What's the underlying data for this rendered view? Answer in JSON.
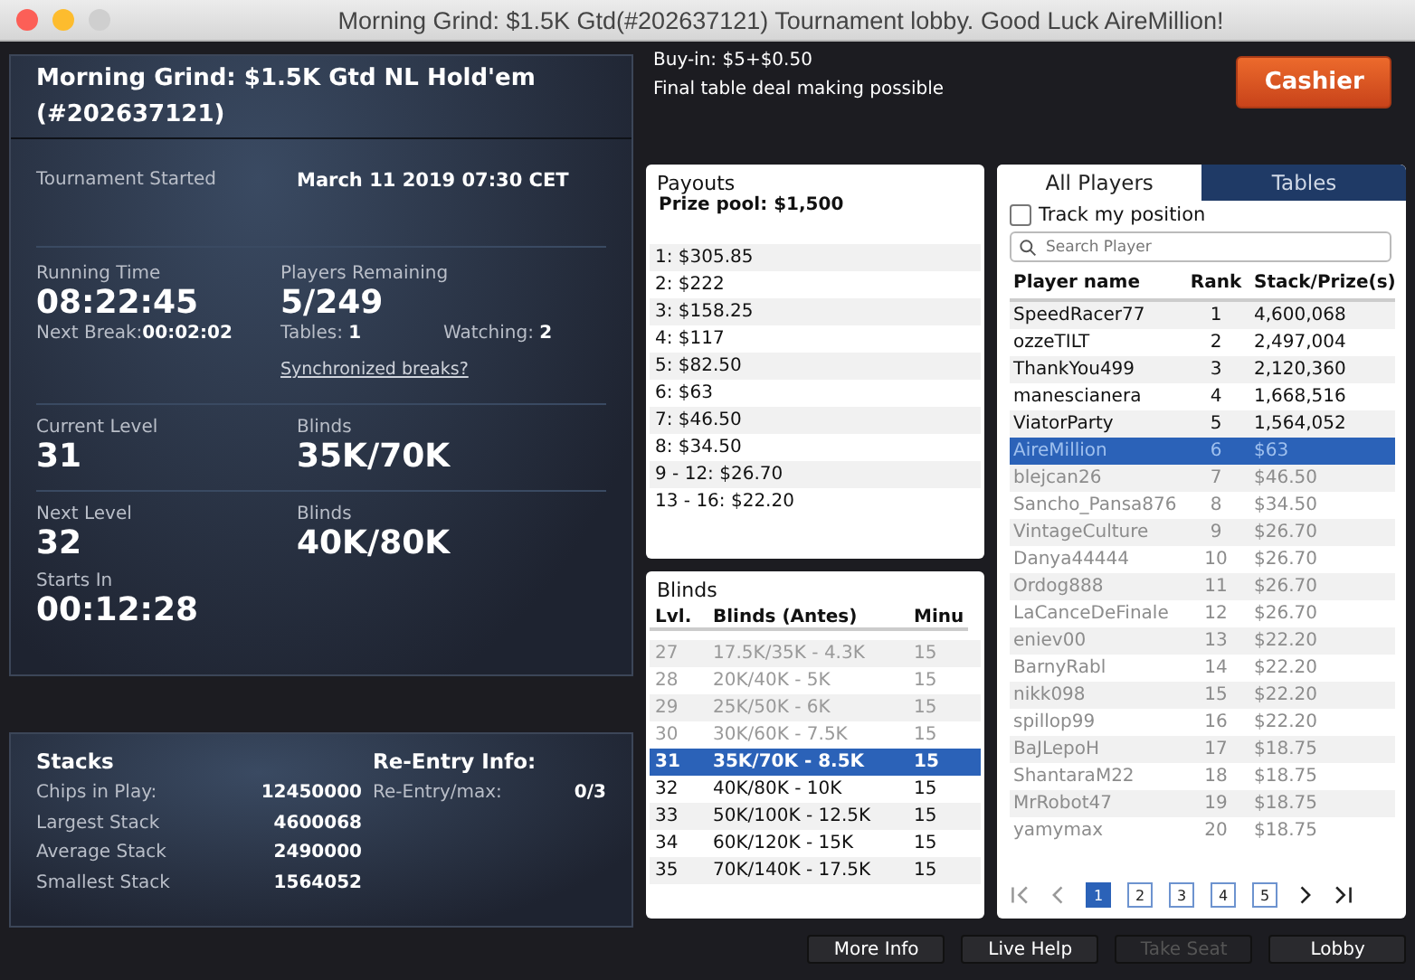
{
  "window": {
    "title": "Morning Grind: $1.5K Gtd(#202637121) Tournament lobby. Good Luck AireMillion!"
  },
  "tournament": {
    "name": "Morning Grind: $1.5K Gtd NL Hold'em (#202637121)",
    "started_label": "Tournament Started",
    "started_value": "March 11 2019 07:30 CET",
    "running_label": "Running Time",
    "running_value": "08:22:45",
    "next_break_label": "Next Break:",
    "next_break_value": "00:02:02",
    "players_label": "Players Remaining",
    "players_value": "5/249",
    "tables_label": "Tables:",
    "tables_value": "1",
    "watching_label": "Watching:",
    "watching_value": "2",
    "sync_link": "Synchronized breaks?",
    "current_level_label": "Current Level",
    "current_level_value": "31",
    "current_blinds_label": "Blinds",
    "current_blinds_value": "35K/70K",
    "next_level_label": "Next Level",
    "next_level_value": "32",
    "next_blinds_label": "Blinds",
    "next_blinds_value": "40K/80K",
    "starts_in_label": "Starts In",
    "starts_in_value": "00:12:28"
  },
  "info": {
    "buy_in": "Buy-in: $5+$0.50",
    "deal": "Final table deal making possible"
  },
  "cashier_button": "Cashier",
  "stacks": {
    "title": "Stacks",
    "rows": [
      {
        "label": "Chips in Play:",
        "value": "12450000"
      },
      {
        "label": "Largest Stack",
        "value": "4600068"
      },
      {
        "label": "Average Stack",
        "value": "2490000"
      },
      {
        "label": "Smallest Stack",
        "value": "1564052"
      }
    ],
    "reentry_title": "Re-Entry Info:",
    "reentry_label": "Re-Entry/max:",
    "reentry_value": "0/3"
  },
  "payouts": {
    "title": "Payouts",
    "prize_pool": "Prize pool: $1,500",
    "rows": [
      "1: $305.85",
      "2: $222",
      "3: $158.25",
      "4: $117",
      "5: $82.50",
      "6: $63",
      "7: $46.50",
      "8: $34.50",
      "9 - 12: $26.70",
      "13 - 16: $22.20"
    ]
  },
  "blinds": {
    "title": "Blinds",
    "columns": [
      "Lvl.",
      "Blinds (Antes)",
      "Minu"
    ],
    "rows": [
      {
        "level": "27",
        "blinds": "17.5K/35K - 4.3K",
        "minutes": "15",
        "past": true,
        "selected": false
      },
      {
        "level": "28",
        "blinds": "20K/40K - 5K",
        "minutes": "15",
        "past": true,
        "selected": false
      },
      {
        "level": "29",
        "blinds": "25K/50K - 6K",
        "minutes": "15",
        "past": true,
        "selected": false
      },
      {
        "level": "30",
        "blinds": "30K/60K - 7.5K",
        "minutes": "15",
        "past": true,
        "selected": false
      },
      {
        "level": "31",
        "blinds": "35K/70K - 8.5K",
        "minutes": "15",
        "past": false,
        "selected": true
      },
      {
        "level": "32",
        "blinds": "40K/80K - 10K",
        "minutes": "15",
        "past": false,
        "selected": false
      },
      {
        "level": "33",
        "blinds": "50K/100K - 12.5K",
        "minutes": "15",
        "past": false,
        "selected": false
      },
      {
        "level": "34",
        "blinds": "60K/120K - 15K",
        "minutes": "15",
        "past": false,
        "selected": false
      },
      {
        "level": "35",
        "blinds": "70K/140K - 17.5K",
        "minutes": "15",
        "past": false,
        "selected": false
      }
    ]
  },
  "player_tabs": [
    {
      "label": "All Players",
      "selected": true
    },
    {
      "label": "Tables",
      "selected": false
    }
  ],
  "track_position": {
    "label": "Track my position",
    "checked": false
  },
  "search": {
    "placeholder": "Search Player"
  },
  "players": {
    "columns": [
      "Player name",
      "Rank",
      "Stack/Prize(s)"
    ],
    "rows": [
      {
        "name": "SpeedRacer77",
        "rank": "1",
        "stack": "4,600,068",
        "finished": false,
        "selected": false
      },
      {
        "name": "ozzeTILT",
        "rank": "2",
        "stack": "2,497,004",
        "finished": false,
        "selected": false
      },
      {
        "name": "ThankYou499",
        "rank": "3",
        "stack": "2,120,360",
        "finished": false,
        "selected": false
      },
      {
        "name": "manescianera",
        "rank": "4",
        "stack": "1,668,516",
        "finished": false,
        "selected": false
      },
      {
        "name": "ViatorParty",
        "rank": "5",
        "stack": "1,564,052",
        "finished": false,
        "selected": false
      },
      {
        "name": "AireMillion",
        "rank": "6",
        "stack": "$63",
        "finished": true,
        "selected": true
      },
      {
        "name": "blejcan26",
        "rank": "7",
        "stack": "$46.50",
        "finished": true,
        "selected": false
      },
      {
        "name": "Sancho_Pansa876",
        "rank": "8",
        "stack": "$34.50",
        "finished": true,
        "selected": false
      },
      {
        "name": "VintageCulture",
        "rank": "9",
        "stack": "$26.70",
        "finished": true,
        "selected": false
      },
      {
        "name": "Danya44444",
        "rank": "10",
        "stack": "$26.70",
        "finished": true,
        "selected": false
      },
      {
        "name": "Ordog888",
        "rank": "11",
        "stack": "$26.70",
        "finished": true,
        "selected": false
      },
      {
        "name": "LaCanceDeFinale",
        "rank": "12",
        "stack": "$26.70",
        "finished": true,
        "selected": false
      },
      {
        "name": "eniev00",
        "rank": "13",
        "stack": "$22.20",
        "finished": true,
        "selected": false
      },
      {
        "name": "BarnyRabl",
        "rank": "14",
        "stack": "$22.20",
        "finished": true,
        "selected": false
      },
      {
        "name": "nikk098",
        "rank": "15",
        "stack": "$22.20",
        "finished": true,
        "selected": false
      },
      {
        "name": "spillop99",
        "rank": "16",
        "stack": "$22.20",
        "finished": true,
        "selected": false
      },
      {
        "name": "BaJLepoH",
        "rank": "17",
        "stack": "$18.75",
        "finished": true,
        "selected": false
      },
      {
        "name": "ShantaraM22",
        "rank": "18",
        "stack": "$18.75",
        "finished": true,
        "selected": false
      },
      {
        "name": "MrRobot47",
        "rank": "19",
        "stack": "$18.75",
        "finished": true,
        "selected": false
      },
      {
        "name": "yamymax",
        "rank": "20",
        "stack": "$18.75",
        "finished": true,
        "selected": false
      }
    ]
  },
  "pages": [
    {
      "label": "1",
      "selected": true
    },
    {
      "label": "2",
      "selected": false
    },
    {
      "label": "3",
      "selected": false
    },
    {
      "label": "4",
      "selected": false
    },
    {
      "label": "5",
      "selected": false
    }
  ],
  "bottom_buttons": [
    {
      "label": "More Info",
      "disabled": false
    },
    {
      "label": "Live Help",
      "disabled": false
    },
    {
      "label": "Take Seat",
      "disabled": true
    },
    {
      "label": "Lobby",
      "disabled": false
    }
  ]
}
